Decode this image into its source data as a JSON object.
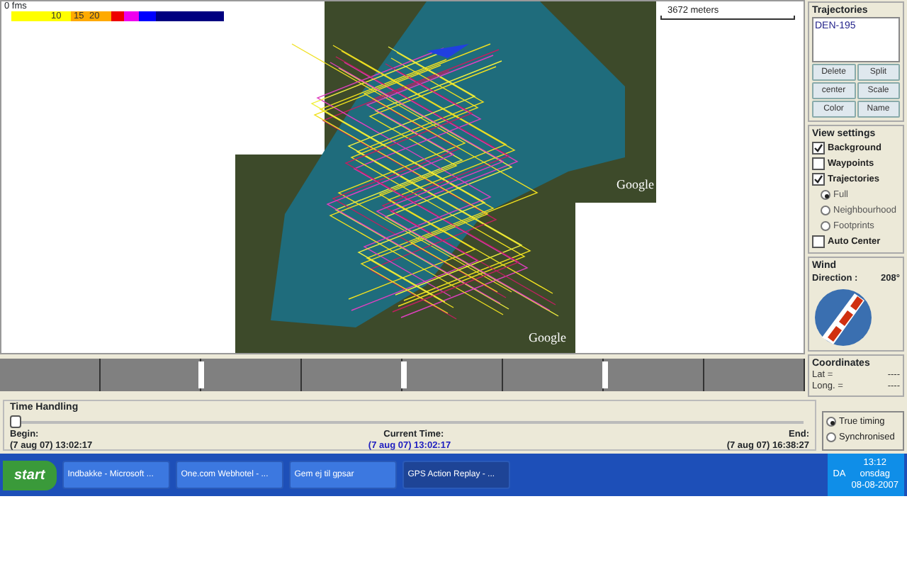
{
  "legend": {
    "unit_label": "0 fms",
    "ticks": [
      "10",
      "15",
      "20"
    ]
  },
  "map": {
    "scale_label": "3672 meters",
    "attributions": [
      "Google",
      "Google"
    ]
  },
  "trajectories": {
    "title": "Trajectories",
    "items": [
      {
        "label": "DEN-195",
        "selected": false
      }
    ],
    "buttons": [
      "Delete",
      "Split",
      "center",
      "Scale",
      "Color",
      "Name"
    ]
  },
  "view_settings": {
    "title": "View settings",
    "options": [
      {
        "kind": "checkbox",
        "label": "Background",
        "checked": true
      },
      {
        "kind": "checkbox",
        "label": "Waypoints",
        "checked": false
      },
      {
        "kind": "checkbox",
        "label": "Trajectories",
        "checked": true
      },
      {
        "kind": "radio",
        "label": "Full",
        "selected": true
      },
      {
        "kind": "radio",
        "label": "Neighbourhood",
        "selected": false
      },
      {
        "kind": "radio",
        "label": "Footprints",
        "selected": false
      },
      {
        "kind": "checkbox",
        "label": "Auto Center",
        "checked": false
      }
    ]
  },
  "wind": {
    "title": "Wind",
    "direction_label": "Direction :",
    "direction": "208°"
  },
  "coordinates": {
    "title": "Coordinates",
    "rows": [
      {
        "label": "Lat =",
        "value": "----"
      },
      {
        "label": "Long. =",
        "value": "----"
      }
    ]
  },
  "time_handling": {
    "title": "Time Handling",
    "level": 0.0,
    "begin_label": "Begin:",
    "begin": "(7 aug 07) 13:02:17",
    "current_label": "Current Time:",
    "current": "(7 aug 07) 13:02:17",
    "end_label": "End:",
    "end": "(7 aug 07) 16:38:27",
    "modes": [
      {
        "label": "True timing",
        "selected": true
      },
      {
        "label": "Synchronised",
        "selected": false
      }
    ]
  },
  "taskbar": {
    "start": "start",
    "tasks": [
      {
        "label": "Indbakke - Microsoft ...",
        "selected": false
      },
      {
        "label": "One.com Webhotel - ...",
        "selected": false
      },
      {
        "label": "Gem ej til gpsar",
        "selected": false
      },
      {
        "label": "GPS Action Replay - ...",
        "selected": true
      }
    ],
    "language": "DA",
    "time": "13:12",
    "day": "onsdag",
    "date": "08-08-2007"
  }
}
